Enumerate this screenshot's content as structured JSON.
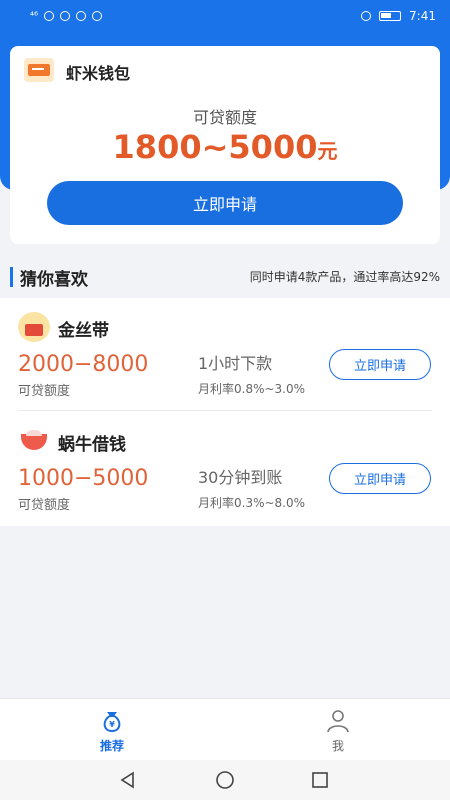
{
  "status_bar": {
    "network": "⁴⁶",
    "time": "7:41"
  },
  "hero": {
    "name": "虾米钱包",
    "label": "可贷额度",
    "amount": "1800~5000",
    "unit": "元",
    "button": "立即申请"
  },
  "section": {
    "title": "猜你喜欢",
    "note": "同时申请4款产品，通过率高达92%"
  },
  "products": [
    {
      "name": "金丝带",
      "range": "2000−8000",
      "range_label": "可贷额度",
      "speed": "1小时下款",
      "rate": "月利率0.8%~3.0%",
      "button": "立即申请",
      "icon": "gold-ribbon-icon"
    },
    {
      "name": "蜗牛借钱",
      "range": "1000−5000",
      "range_label": "可贷额度",
      "speed": "30分钟到账",
      "rate": "月利率0.3%~8.0%",
      "button": "立即申请",
      "icon": "snail-bowl-icon"
    }
  ],
  "tabs": [
    {
      "label": "推荐",
      "icon": "money-bag-icon",
      "active": true
    },
    {
      "label": "我",
      "icon": "person-icon",
      "active": false
    }
  ],
  "colors": {
    "primary": "#1a73e8",
    "accent": "#e35a29",
    "background": "#f2f3f7"
  }
}
